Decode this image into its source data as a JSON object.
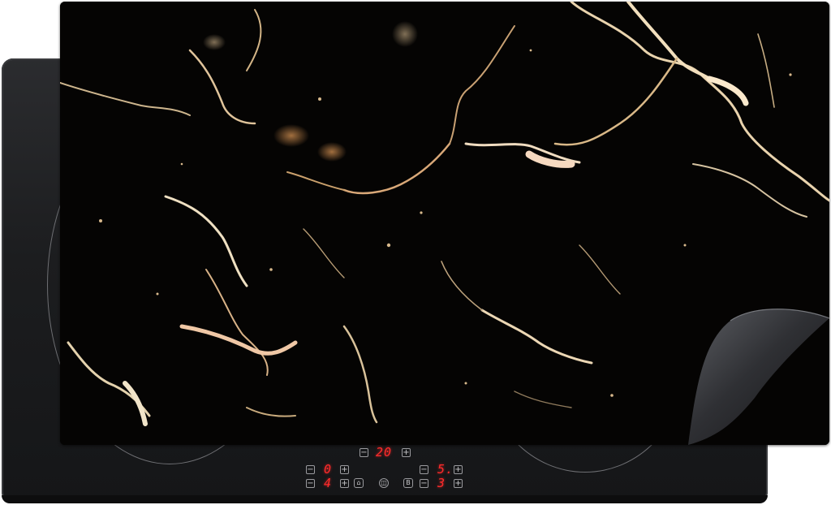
{
  "image": {
    "colors": {
      "background": "#ffffff",
      "cooktop": "#1f2022",
      "marble": "#050403",
      "vein_gold": "#e8c89a",
      "vein_cream": "#f4e6cc",
      "display_red": "#ff2b2b"
    }
  },
  "controls": {
    "timer": {
      "minus": "−",
      "value": "20",
      "plus": "+"
    },
    "zone_front_left": {
      "minus": "−",
      "value": "0",
      "plus": "+"
    },
    "zone_rear_left": {
      "minus": "−",
      "value": "4",
      "plus": "+"
    },
    "zone_front_right": {
      "minus": "−",
      "value": "5.",
      "plus": "+"
    },
    "zone_rear_right": {
      "minus": "−",
      "value": "3",
      "plus": "+"
    },
    "booster_label": "B",
    "icons": [
      "lock-icon",
      "pause-icon",
      "booster-icon"
    ]
  }
}
